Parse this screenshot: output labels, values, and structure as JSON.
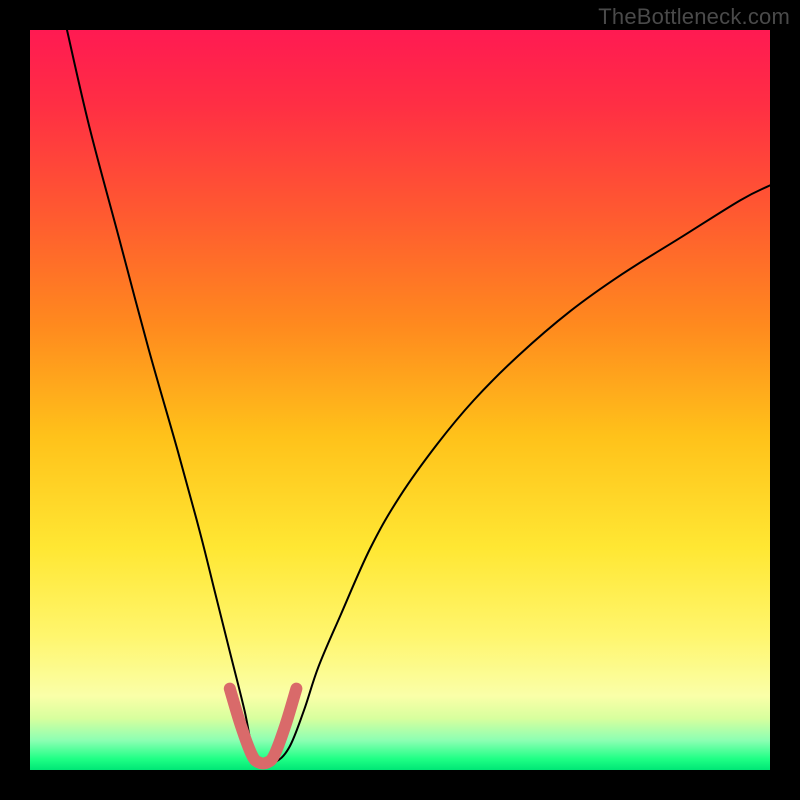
{
  "watermark": "TheBottleneck.com",
  "chart_data": {
    "type": "line",
    "title": "",
    "xlabel": "",
    "ylabel": "",
    "xlim": [
      0,
      100
    ],
    "ylim": [
      0,
      100
    ],
    "grid": false,
    "legend": false,
    "series": [
      {
        "name": "main-curve",
        "stroke": "#000000",
        "stroke_width": 2,
        "x": [
          5,
          8,
          12,
          16,
          20,
          23,
          25,
          27,
          29,
          30,
          31,
          33,
          35,
          37,
          39,
          42,
          46,
          50,
          55,
          60,
          66,
          73,
          80,
          88,
          96,
          100
        ],
        "y": [
          100,
          87,
          72,
          57,
          43,
          32,
          24,
          16,
          8,
          3,
          1,
          1,
          3,
          8,
          14,
          21,
          30,
          37,
          44,
          50,
          56,
          62,
          67,
          72,
          77,
          79
        ]
      },
      {
        "name": "highlight-segment",
        "stroke": "#d96a6a",
        "stroke_width": 12,
        "linecap": "round",
        "x": [
          27,
          28.5,
          30,
          31,
          32,
          33,
          34.5,
          36
        ],
        "y": [
          11,
          6,
          2,
          1,
          1,
          2,
          6,
          11
        ]
      }
    ],
    "background_gradient": {
      "stops": [
        {
          "offset": 0.0,
          "color": "#ff1a52"
        },
        {
          "offset": 0.1,
          "color": "#ff2e44"
        },
        {
          "offset": 0.25,
          "color": "#ff5a30"
        },
        {
          "offset": 0.4,
          "color": "#ff8a1e"
        },
        {
          "offset": 0.55,
          "color": "#ffc21a"
        },
        {
          "offset": 0.7,
          "color": "#ffe733"
        },
        {
          "offset": 0.82,
          "color": "#fff66e"
        },
        {
          "offset": 0.9,
          "color": "#faffa8"
        },
        {
          "offset": 0.93,
          "color": "#d8ff9e"
        },
        {
          "offset": 0.96,
          "color": "#8cffb3"
        },
        {
          "offset": 0.985,
          "color": "#1fff85"
        },
        {
          "offset": 1.0,
          "color": "#00e676"
        }
      ]
    }
  }
}
